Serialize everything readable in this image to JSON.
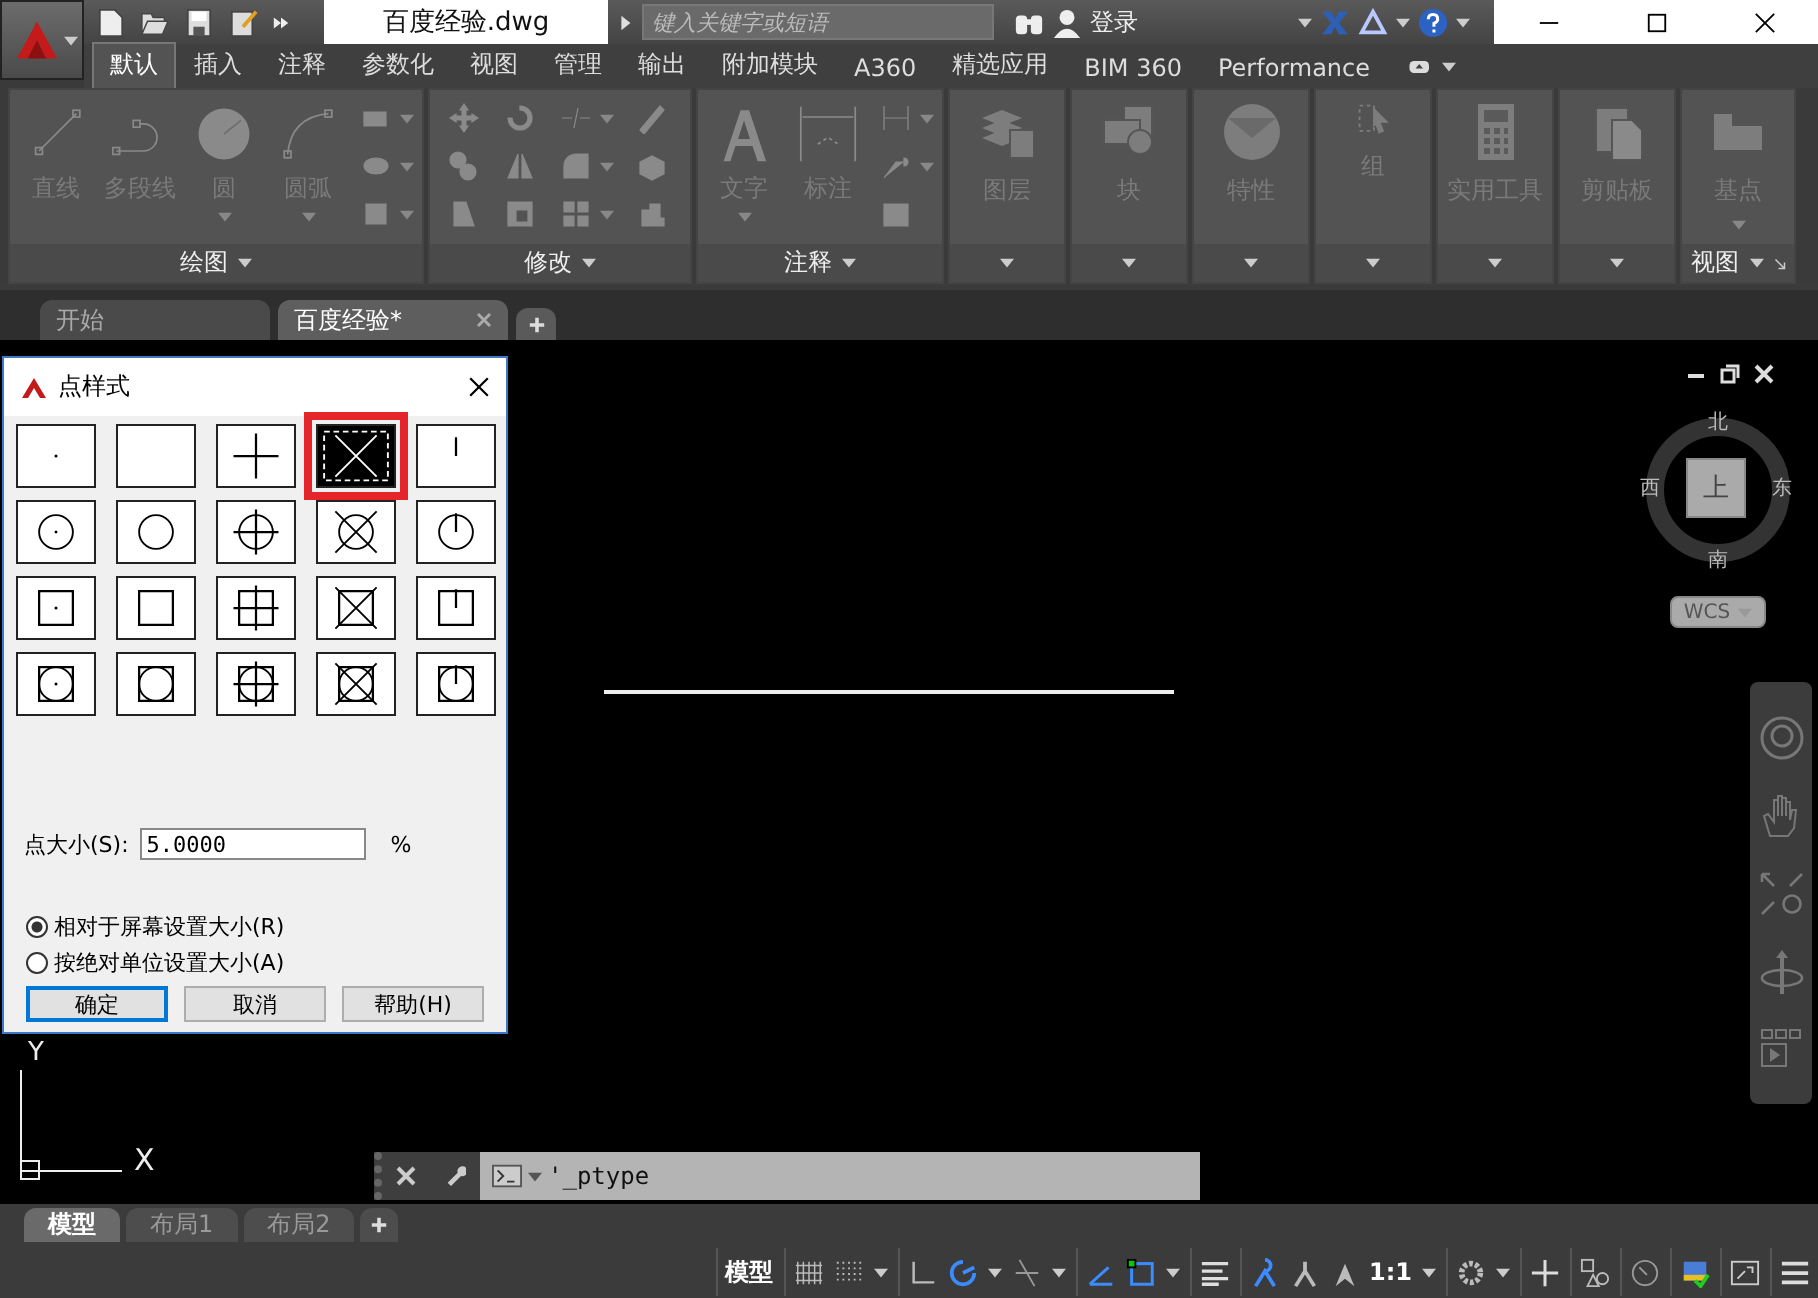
{
  "title_bar": {
    "document_title": "百度经验.dwg",
    "search": {
      "placeholder": "键入关键字或短语"
    },
    "sign_in": "登录"
  },
  "ribbon_tabs": [
    {
      "label": "默认",
      "selected": true
    },
    {
      "label": "插入",
      "selected": false
    },
    {
      "label": "注释",
      "selected": false
    },
    {
      "label": "参数化",
      "selected": false
    },
    {
      "label": "视图",
      "selected": false
    },
    {
      "label": "管理",
      "selected": false
    },
    {
      "label": "输出",
      "selected": false
    },
    {
      "label": "附加模块",
      "selected": false
    },
    {
      "label": "A360",
      "selected": false
    },
    {
      "label": "精选应用",
      "selected": false
    },
    {
      "label": "BIM 360",
      "selected": false
    },
    {
      "label": "Performance",
      "selected": false
    }
  ],
  "ribbon_panels": [
    {
      "kind": "draw",
      "title": "绘图",
      "tools": [
        {
          "kind": "line",
          "label": "直线"
        },
        {
          "kind": "polyline",
          "label": "多段线"
        },
        {
          "kind": "circle",
          "label": "圆"
        },
        {
          "kind": "arc",
          "label": "圆弧"
        }
      ]
    },
    {
      "kind": "modify",
      "title": "修改"
    },
    {
      "kind": "annotation",
      "title": "注释",
      "tools": [
        {
          "kind": "text",
          "label": "文字"
        },
        {
          "kind": "dimension",
          "label": "标注"
        }
      ]
    },
    {
      "kind": "layers",
      "label": "图层"
    },
    {
      "kind": "block",
      "label": "块"
    },
    {
      "kind": "properties",
      "label": "特性"
    },
    {
      "kind": "group",
      "label": "组"
    },
    {
      "kind": "utilities",
      "label": "实用工具"
    },
    {
      "kind": "clipboard",
      "label": "剪贴板"
    },
    {
      "kind": "view",
      "label": "基点",
      "title": "视图"
    }
  ],
  "file_tabs": [
    {
      "label": "开始",
      "selected": false
    },
    {
      "label": "百度经验*",
      "selected": true
    }
  ],
  "dialog": {
    "title": "点样式",
    "point_styles": [
      {
        "kind": "dot",
        "selected": false
      },
      {
        "kind": "blank",
        "selected": false
      },
      {
        "kind": "plus",
        "selected": false
      },
      {
        "kind": "cross",
        "selected": true
      },
      {
        "kind": "tick",
        "selected": false
      },
      {
        "kind": "circle-dot",
        "selected": false
      },
      {
        "kind": "circle",
        "selected": false
      },
      {
        "kind": "circle-plus",
        "selected": false
      },
      {
        "kind": "circle-cross",
        "selected": false
      },
      {
        "kind": "circle-tick",
        "selected": false
      },
      {
        "kind": "square-dot",
        "selected": false
      },
      {
        "kind": "square",
        "selected": false
      },
      {
        "kind": "square-plus",
        "selected": false
      },
      {
        "kind": "square-cross",
        "selected": false
      },
      {
        "kind": "square-tick",
        "selected": false
      },
      {
        "kind": "circle-square-dot",
        "selected": false
      },
      {
        "kind": "circle-square",
        "selected": false
      },
      {
        "kind": "circle-square-plus",
        "selected": false
      },
      {
        "kind": "circle-square-cross",
        "selected": false
      },
      {
        "kind": "circle-square-tick",
        "selected": false
      }
    ],
    "size_label": "点大小(S):",
    "size_value": "5.0000",
    "size_unit": "%",
    "size_modes": [
      {
        "label": "相对于屏幕设置大小(R)",
        "selected": true
      },
      {
        "label": "按绝对单位设置大小(A)",
        "selected": false
      }
    ],
    "buttons": [
      {
        "label": "确定",
        "default": true
      },
      {
        "label": "取消",
        "default": false
      },
      {
        "label": "帮助(H)",
        "default": false
      }
    ]
  },
  "viewcube": {
    "north": "北",
    "west": "西",
    "face": "上",
    "east": "东",
    "south": "南",
    "ucs_menu": "WCS"
  },
  "ucs_icon": {
    "y_label": "Y",
    "x_label": "X"
  },
  "command_line": {
    "value": "'_ptype"
  },
  "layout_tabs": [
    {
      "label": "模型",
      "selected": true
    },
    {
      "label": "布局1",
      "selected": false
    },
    {
      "label": "布局2",
      "selected": false
    }
  ],
  "status_bar": {
    "space": "模型",
    "scale": "1:1"
  }
}
